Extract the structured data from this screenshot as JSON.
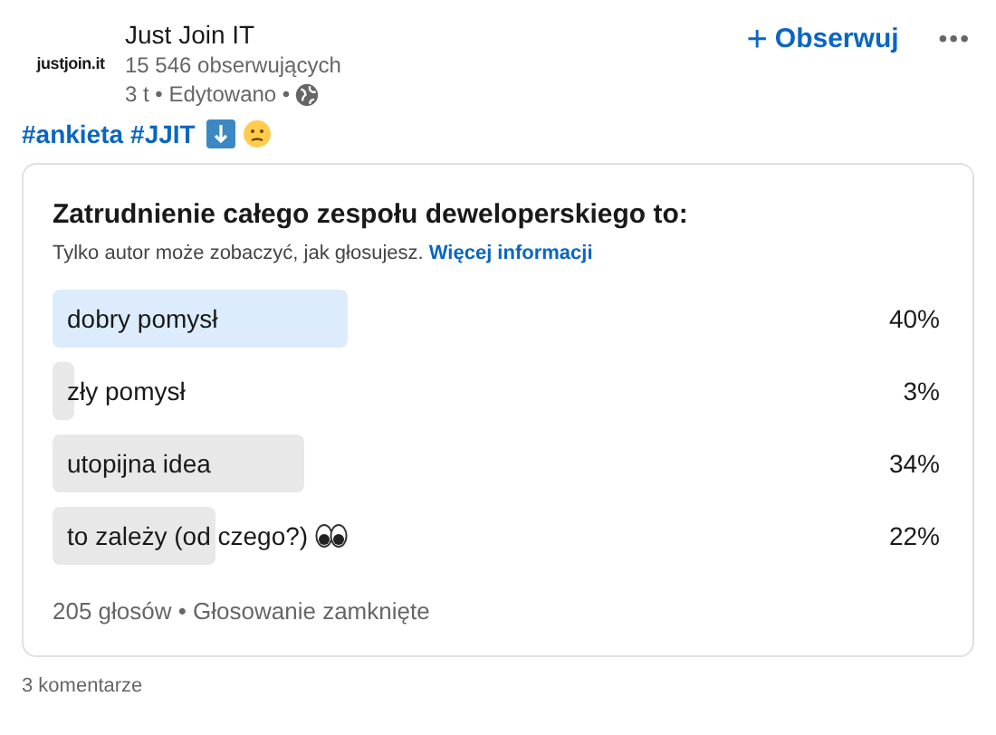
{
  "author": {
    "logo": "justjoin.it",
    "name": "Just Join IT",
    "followers": "15 546 obserwujących",
    "meta": "3 t • Edytowano •"
  },
  "follow_button": {
    "icon": "+",
    "label": "Obserwuj"
  },
  "more_button": "•••",
  "hashtags": [
    "#ankieta",
    "#JJIT"
  ],
  "poll": {
    "question": "Zatrudnienie całego zespołu deweloperskiego to:",
    "note": "Tylko autor może zobaczyć, jak głosujesz.",
    "note_link": "Więcej informacji",
    "options": [
      {
        "label": "dobry pomysł",
        "percent": "40%",
        "selected": true,
        "emoji": false
      },
      {
        "label": "zły pomysł",
        "percent": "3%",
        "selected": false,
        "emoji": false
      },
      {
        "label": "utopijna idea",
        "percent": "34%",
        "selected": false,
        "emoji": false
      },
      {
        "label": "to zależy (od czego?)",
        "percent": "22%",
        "selected": false,
        "emoji": true
      }
    ],
    "footer": "205 głosów • Głosowanie zamknięte"
  },
  "comments": "3 komentarze"
}
